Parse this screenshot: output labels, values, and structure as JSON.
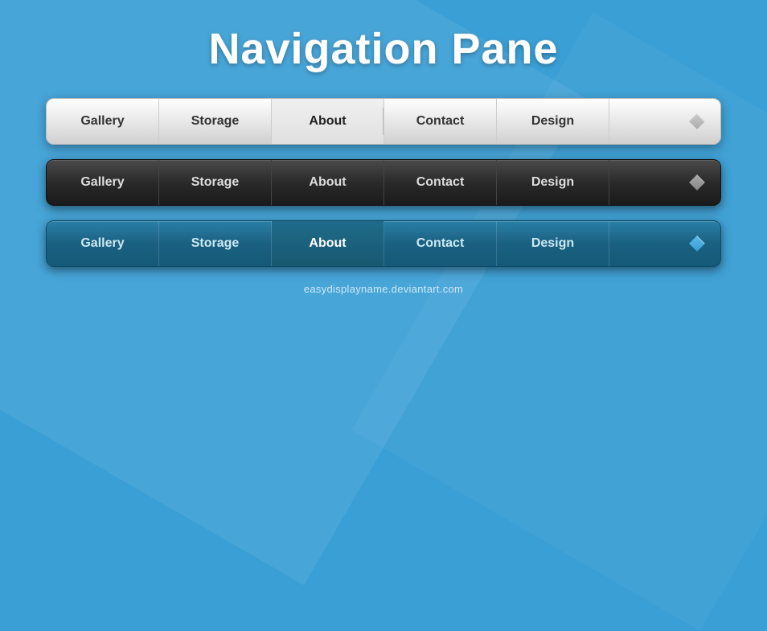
{
  "page": {
    "title": "Navigation Pane",
    "footer": "easydisplayname.deviantart.com"
  },
  "nav_bars": [
    {
      "id": "light",
      "theme": "light",
      "items": [
        {
          "label": "Gallery",
          "active": false
        },
        {
          "label": "Storage",
          "active": false
        },
        {
          "label": "About",
          "active": true
        },
        {
          "label": "Contact",
          "active": false
        },
        {
          "label": "Design",
          "active": false
        }
      ]
    },
    {
      "id": "dark",
      "theme": "dark",
      "items": [
        {
          "label": "Gallery",
          "active": false
        },
        {
          "label": "Storage",
          "active": false
        },
        {
          "label": "About",
          "active": false
        },
        {
          "label": "Contact",
          "active": false
        },
        {
          "label": "Design",
          "active": false
        }
      ]
    },
    {
      "id": "blue",
      "theme": "blue",
      "items": [
        {
          "label": "Gallery",
          "active": false
        },
        {
          "label": "Storage",
          "active": false
        },
        {
          "label": "About",
          "active": true
        },
        {
          "label": "Contact",
          "active": false
        },
        {
          "label": "Design",
          "active": false
        }
      ]
    }
  ],
  "icons": {
    "dropdown": "diamond"
  }
}
